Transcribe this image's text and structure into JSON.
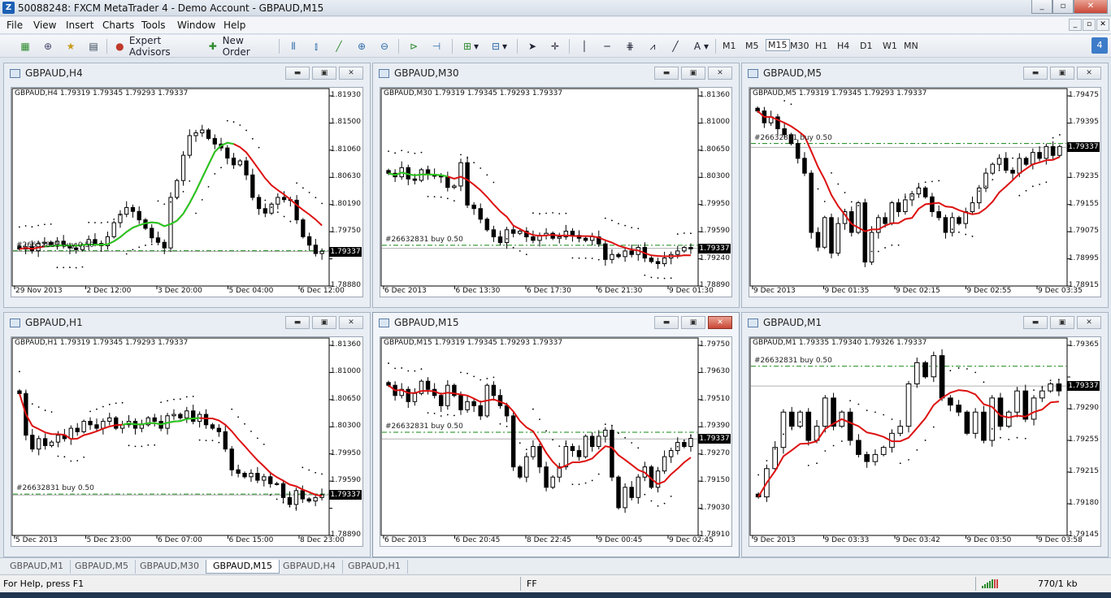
{
  "window": {
    "title": "50088248: FXCM MetaTrader 4 - Demo Account - GBPAUD,M15",
    "app_icon": "mt4-icon"
  },
  "menu": [
    "File",
    "View",
    "Insert",
    "Charts",
    "Tools",
    "Window",
    "Help"
  ],
  "toolbar": {
    "expert_advisors": "Expert Advisors",
    "new_order": "New Order",
    "timeframes": [
      "M1",
      "M5",
      "M15",
      "M30",
      "H1",
      "H4",
      "D1",
      "W1",
      "MN"
    ],
    "active_timeframe": "M15"
  },
  "colors": {
    "ma_red": "#dd1111",
    "ma_green": "#22cc22",
    "order_line": "#118811",
    "candle": "#000000"
  },
  "charts": [
    {
      "key": "h4",
      "window_title": "GBPAUD,H4",
      "header": "GBPAUD,H4  1.79319 1.79345 1.79293 1.79337",
      "order_label": "#26632831 buy 0.50",
      "current_price": "1.79337",
      "price_ticks": [
        "1.81930",
        "1.81500",
        "1.81060",
        "1.80630",
        "1.80190",
        "1.79750",
        "1.79337",
        "1.78880"
      ],
      "time_ticks": [
        "29 Nov 2013",
        "2 Dec 12:00",
        "3 Dec 20:00",
        "5 Dec 04:00",
        "6 Dec 12:00"
      ],
      "chart_data": {
        "type": "candlestick",
        "ylim": [
          1.7878,
          1.8205
        ],
        "order_price": 1.7935,
        "current_price": 1.79337,
        "values_close": [
          1.7938,
          1.7942,
          1.7935,
          1.7948,
          1.795,
          1.7946,
          1.7952,
          1.7944,
          1.794,
          1.7937,
          1.7945,
          1.7955,
          1.7948,
          1.7944,
          1.796,
          1.7985,
          1.8,
          1.8012,
          1.8005,
          1.799,
          1.7975,
          1.7958,
          1.795,
          1.794,
          1.803,
          1.806,
          1.8105,
          1.814,
          1.8145,
          1.815,
          1.8135,
          1.8125,
          1.8118,
          1.81,
          1.8088,
          1.8095,
          1.807,
          1.803,
          1.801,
          1.8002,
          1.8018,
          1.803,
          1.8026,
          1.8025,
          1.799,
          1.796,
          1.7945,
          1.793,
          1.7934
        ]
      }
    },
    {
      "key": "m30",
      "window_title": "GBPAUD,M30",
      "header": "GBPAUD,M30  1.79319 1.79345 1.79293 1.79337",
      "order_label": "#26632831 buy 0.50",
      "current_price": "1.79337",
      "price_ticks": [
        "1.81360",
        "1.81000",
        "1.80650",
        "1.80300",
        "1.79950",
        "1.79590",
        "1.79240",
        "1.78890"
      ],
      "time_ticks": [
        "6 Dec 2013",
        "6 Dec 13:30",
        "6 Dec 17:30",
        "6 Dec 21:30",
        "9 Dec 01:30"
      ],
      "chart_data": {
        "type": "candlestick",
        "ylim": [
          1.7885,
          1.8145
        ],
        "order_price": 1.7938,
        "current_price": 1.79337,
        "values_close": [
          1.804,
          1.8035,
          1.8048,
          1.8032,
          1.803,
          1.8045,
          1.8038,
          1.8036,
          1.8035,
          1.802,
          1.8022,
          1.8055,
          1.7995,
          1.799,
          1.7975,
          1.796,
          1.795,
          1.7942,
          1.796,
          1.7955,
          1.7958,
          1.795,
          1.7945,
          1.7952,
          1.7955,
          1.7948,
          1.795,
          1.7958,
          1.7952,
          1.7948,
          1.7945,
          1.795,
          1.794,
          1.7918,
          1.7925,
          1.7922,
          1.793,
          1.7925,
          1.7935,
          1.792,
          1.7915,
          1.7912,
          1.792,
          1.7925,
          1.793,
          1.7935,
          1.7933
        ]
      }
    },
    {
      "key": "m5",
      "window_title": "GBPAUD,M5",
      "header": "GBPAUD,M5  1.79319 1.79345 1.79293 1.79337",
      "order_label": "#26632831 buy 0.50",
      "current_price": "1.79337",
      "price_ticks": [
        "1.79475",
        "1.79395",
        "1.79337",
        "1.79235",
        "1.79155",
        "1.79075",
        "1.78995",
        "1.78915"
      ],
      "time_ticks": [
        "9 Dec 2013",
        "9 Dec 01:35",
        "9 Dec 02:15",
        "9 Dec 02:55",
        "9 Dec 03:35"
      ],
      "chart_data": {
        "type": "candlestick",
        "ylim": [
          1.7888,
          1.795
        ],
        "order_price": 1.7935,
        "current_price": 1.79337,
        "values_close": [
          1.7946,
          1.7942,
          1.7944,
          1.794,
          1.7938,
          1.7935,
          1.793,
          1.7925,
          1.7905,
          1.79,
          1.791,
          1.7898,
          1.7908,
          1.7912,
          1.7905,
          1.7915,
          1.7895,
          1.7905,
          1.791,
          1.7908,
          1.7915,
          1.7912,
          1.7916,
          1.7918,
          1.792,
          1.7917,
          1.7912,
          1.791,
          1.7905,
          1.791,
          1.7908,
          1.7912,
          1.7915,
          1.792,
          1.7925,
          1.7928,
          1.793,
          1.7926,
          1.7925,
          1.793,
          1.7928,
          1.7932,
          1.793,
          1.7934,
          1.7931,
          1.7934
        ]
      }
    },
    {
      "key": "h1",
      "window_title": "GBPAUD,H1",
      "header": "GBPAUD,H1  1.79319 1.79345 1.79293 1.79337",
      "order_label": "#26632831 buy 0.50",
      "current_price": "1.79337",
      "price_ticks": [
        "1.81360",
        "1.81000",
        "1.80650",
        "1.80300",
        "1.79950",
        "1.79590",
        "1.79337",
        "1.78890"
      ],
      "time_ticks": [
        "5 Dec 2013",
        "5 Dec 23:00",
        "6 Dec 07:00",
        "6 Dec 15:00",
        "8 Dec 23:00"
      ],
      "chart_data": {
        "type": "candlestick",
        "ylim": [
          1.788,
          1.8145
        ],
        "order_price": 1.7935,
        "current_price": 1.79337,
        "values_close": [
          1.808,
          1.802,
          1.8,
          1.8015,
          1.8005,
          1.801,
          1.802,
          1.8015,
          1.803,
          1.8025,
          1.804,
          1.8035,
          1.803,
          1.804,
          1.8045,
          1.803,
          1.8035,
          1.804,
          1.803,
          1.8035,
          1.8045,
          1.804,
          1.803,
          1.8048,
          1.805,
          1.8045,
          1.8055,
          1.804,
          1.805,
          1.8035,
          1.803,
          1.8025,
          1.8,
          1.797,
          1.7965,
          1.796,
          1.7965,
          1.7955,
          1.796,
          1.795,
          1.795,
          1.793,
          1.792,
          1.794,
          1.7928,
          1.7925,
          1.793,
          1.7934
        ]
      }
    },
    {
      "key": "m15",
      "window_title": "GBPAUD,M15",
      "header": "GBPAUD,M15  1.79319 1.79345 1.79293 1.79337",
      "order_label": "#26632831 buy 0.50",
      "current_price": "1.79337",
      "price_ticks": [
        "1.79750",
        "1.79630",
        "1.79510",
        "1.79390",
        "1.79270",
        "1.79150",
        "1.79030",
        "1.78910"
      ],
      "time_ticks": [
        "6 Dec 2013",
        "6 Dec 20:45",
        "8 Dec 22:45",
        "9 Dec 00:45",
        "9 Dec 02:45"
      ],
      "chart_data": {
        "type": "candlestick",
        "ylim": [
          1.7888,
          1.7978
        ],
        "order_price": 1.7937,
        "current_price": 1.79337,
        "values_close": [
          1.796,
          1.7955,
          1.7958,
          1.7952,
          1.7956,
          1.7962,
          1.7958,
          1.7955,
          1.795,
          1.796,
          1.7955,
          1.7948,
          1.7952,
          1.795,
          1.7945,
          1.796,
          1.7955,
          1.795,
          1.7945,
          1.792,
          1.7915,
          1.7925,
          1.793,
          1.792,
          1.791,
          1.7915,
          1.792,
          1.793,
          1.7928,
          1.7925,
          1.7935,
          1.793,
          1.7935,
          1.7938,
          1.7915,
          1.79,
          1.791,
          1.7905,
          1.7915,
          1.792,
          1.791,
          1.7918,
          1.7925,
          1.7928,
          1.7932,
          1.793,
          1.7934
        ]
      }
    },
    {
      "key": "m1",
      "window_title": "GBPAUD,M1",
      "header": "GBPAUD,M1  1.79335 1.79340 1.79326 1.79337",
      "order_label": "#26632831 buy 0.50",
      "current_price": "1.79337",
      "price_ticks": [
        "1.79365",
        "1.79337",
        "1.79290",
        "1.79255",
        "1.79215",
        "1.79180",
        "1.79145"
      ],
      "time_ticks": [
        "9 Dec 2013",
        "9 Dec 03:33",
        "9 Dec 03:42",
        "9 Dec 03:50",
        "9 Dec 03:58"
      ],
      "chart_data": {
        "type": "candlestick",
        "ylim": [
          1.7913,
          1.7939
        ],
        "order_price": 1.79365,
        "current_price": 1.79337,
        "values_close": [
          1.7918,
          1.7922,
          1.7925,
          1.793,
          1.7928,
          1.793,
          1.7926,
          1.7928,
          1.7932,
          1.7928,
          1.793,
          1.7926,
          1.7924,
          1.7923,
          1.7924,
          1.7925,
          1.7927,
          1.7928,
          1.7934,
          1.7937,
          1.7935,
          1.7938,
          1.7932,
          1.7931,
          1.793,
          1.7927,
          1.793,
          1.7926,
          1.7932,
          1.7928,
          1.793,
          1.7933,
          1.7929,
          1.7932,
          1.7933,
          1.7934,
          1.7933
        ]
      }
    }
  ],
  "tabs": [
    "GBPAUD,M1",
    "GBPAUD,M5",
    "GBPAUD,M30",
    "GBPAUD,M15",
    "GBPAUD,H4",
    "GBPAUD,H1"
  ],
  "active_tab": "GBPAUD,M15",
  "status": {
    "help": "For Help, press F1",
    "profile": "FF",
    "traffic": "770/1 kb"
  }
}
